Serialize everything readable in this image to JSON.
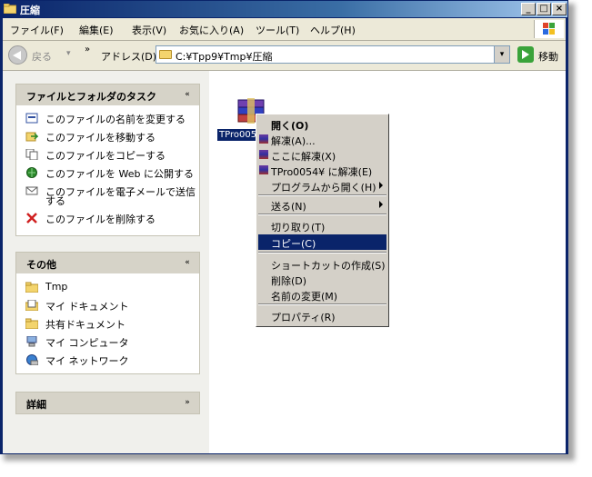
{
  "window": {
    "title": "圧縮",
    "buttons": [
      "_",
      "□",
      "×"
    ]
  },
  "menubar": {
    "items": [
      "ファイル(F)",
      "編集(E)",
      "表示(V)",
      "お気に入り(A)",
      "ツール(T)",
      "ヘルプ(H)"
    ]
  },
  "toolbar": {
    "back_label": "戻る",
    "back_drop": "▾",
    "more": "»",
    "address_label": "アドレス(D)",
    "address_value": "C:¥Tpp9¥Tmp¥圧縮",
    "address_drop": "▾",
    "go_label": "移動"
  },
  "tasks": {
    "file_folder": {
      "title": "ファイルとフォルダのタスク",
      "toggle": "«",
      "items": [
        {
          "label": "このファイルの名前を変更する",
          "icon": "rename-icon"
        },
        {
          "label": "このファイルを移動する",
          "icon": "move-icon"
        },
        {
          "label": "このファイルをコピーする",
          "icon": "copy-icon"
        },
        {
          "label": "このファイルを Web に公開する",
          "icon": "web-publish-icon"
        },
        {
          "label": "このファイルを電子メールで送信",
          "label2": "する",
          "icon": "email-icon"
        },
        {
          "label": "このファイルを削除する",
          "icon": "delete-icon"
        }
      ]
    },
    "other": {
      "title": "その他",
      "toggle": "«",
      "items": [
        {
          "label": "Tmp",
          "icon": "folder-icon"
        },
        {
          "label": "マイ ドキュメント",
          "icon": "my-documents-icon"
        },
        {
          "label": "共有ドキュメント",
          "icon": "shared-folder-icon"
        },
        {
          "label": "マイ コンピュータ",
          "icon": "my-computer-icon"
        },
        {
          "label": "マイ ネットワーク",
          "icon": "my-network-icon"
        }
      ]
    },
    "details": {
      "title": "詳細",
      "toggle": "»"
    }
  },
  "file": {
    "name": "TPro005"
  },
  "context_menu": {
    "items": [
      {
        "label": "開く(O)",
        "bold": true
      },
      {
        "label": "解凍(A)...",
        "icon": "rar-icon"
      },
      {
        "label": "ここに解凍(X)",
        "icon": "rar-icon"
      },
      {
        "label": "TPro0054¥ に解凍(E)",
        "icon": "rar-icon"
      },
      {
        "label": "プログラムから開く(H)",
        "submenu": true
      },
      {
        "label": "送る(N)",
        "submenu": true
      },
      {
        "label": "切り取り(T)"
      },
      {
        "label": "コピー(C)",
        "highlighted": true
      },
      {
        "label": "ショートカットの作成(S)"
      },
      {
        "label": "削除(D)"
      },
      {
        "label": "名前の変更(M)"
      },
      {
        "label": "プロパティ(R)"
      }
    ]
  },
  "colors": {
    "selection": "#0a246a",
    "titlebar": "#0a246a",
    "task_background": "#f0f0ec"
  }
}
